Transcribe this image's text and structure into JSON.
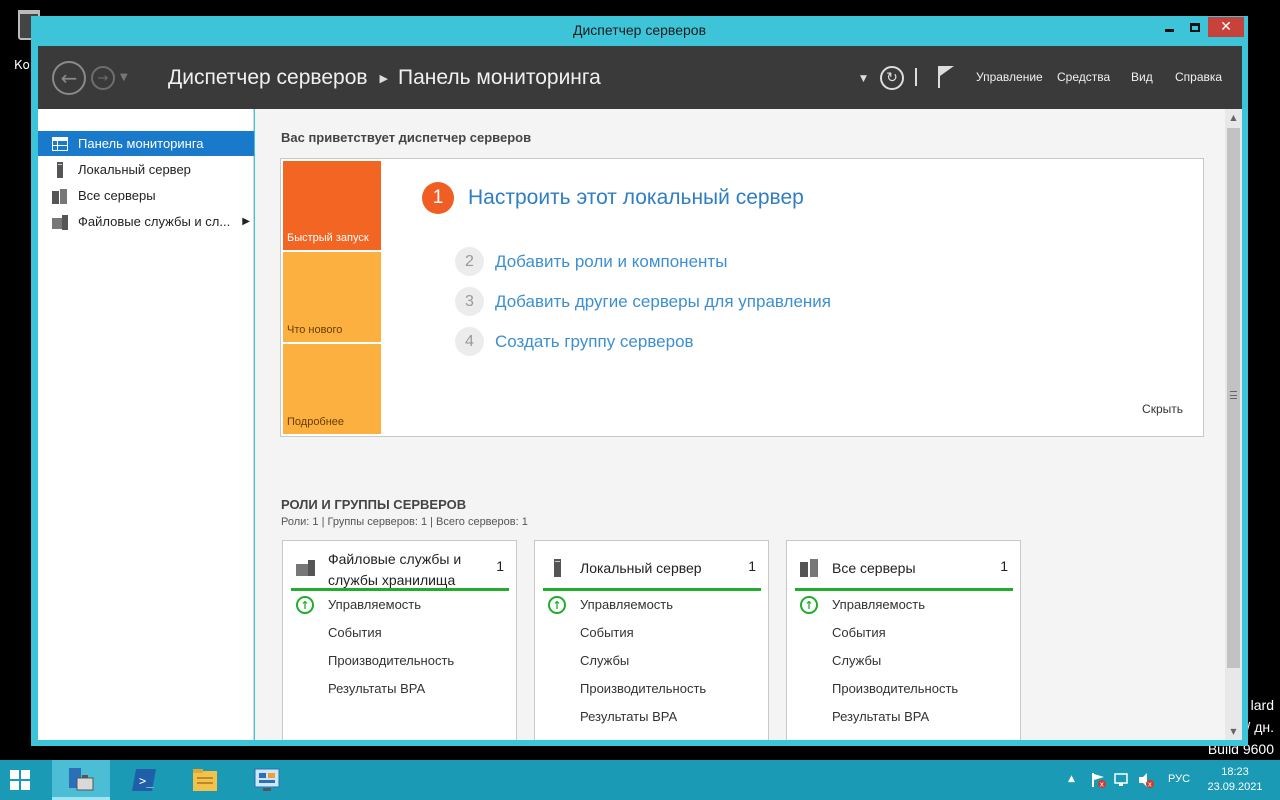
{
  "window": {
    "title": "Диспетчер серверов"
  },
  "desktop": {
    "recycle_label": "Кор",
    "watermark": [
      "lard",
      "/ дн.",
      "Build 9600"
    ]
  },
  "header": {
    "breadcrumb_root": "Диспетчер серверов",
    "breadcrumb_current": "Панель мониторинга",
    "menu": [
      "Управление",
      "Средства",
      "Вид",
      "Справка"
    ]
  },
  "sidebar": {
    "items": [
      {
        "label": "Панель мониторинга",
        "icon": "dashboard-icon",
        "active": true
      },
      {
        "label": "Локальный сервер",
        "icon": "server-icon",
        "active": false
      },
      {
        "label": "Все серверы",
        "icon": "servers-icon",
        "active": false
      },
      {
        "label": "Файловые службы и сл...",
        "icon": "file-services-icon",
        "active": false
      }
    ]
  },
  "welcome": {
    "title": "Вас приветствует диспетчер серверов",
    "tiles": [
      "Быстрый запуск",
      "Что нового",
      "Подробнее"
    ],
    "step1": {
      "num": "1",
      "text": "Настроить этот локальный сервер"
    },
    "steps": [
      {
        "num": "2",
        "text": "Добавить роли и компоненты"
      },
      {
        "num": "3",
        "text": "Добавить другие серверы для управления"
      },
      {
        "num": "4",
        "text": "Создать группу серверов"
      }
    ],
    "hide": "Скрыть",
    "colors": {
      "tile1": "#f26522",
      "tile2": "#fbb040",
      "tile3": "#fbb040",
      "accent": "#f05e24"
    }
  },
  "roles": {
    "title": "РОЛИ И ГРУППЫ СЕРВЕРОВ",
    "subtitle": "Роли: 1 | Группы серверов: 1 | Всего серверов: 1",
    "cards": [
      {
        "title": "Файловые службы и службы хранилища",
        "count": "1",
        "icon": "file-services-icon",
        "rows": [
          "Управляемость",
          "События",
          "Производительность",
          "Результаты BPA"
        ]
      },
      {
        "title": "Локальный сервер",
        "count": "1",
        "icon": "server-icon",
        "rows": [
          "Управляемость",
          "События",
          "Службы",
          "Производительность",
          "Результаты BPA"
        ]
      },
      {
        "title": "Все серверы",
        "count": "1",
        "icon": "servers-icon",
        "rows": [
          "Управляемость",
          "События",
          "Службы",
          "Производительность",
          "Результаты BPA"
        ]
      }
    ]
  },
  "taskbar": {
    "lang": "РУС",
    "time": "18:23",
    "date": "23.09.2021"
  }
}
